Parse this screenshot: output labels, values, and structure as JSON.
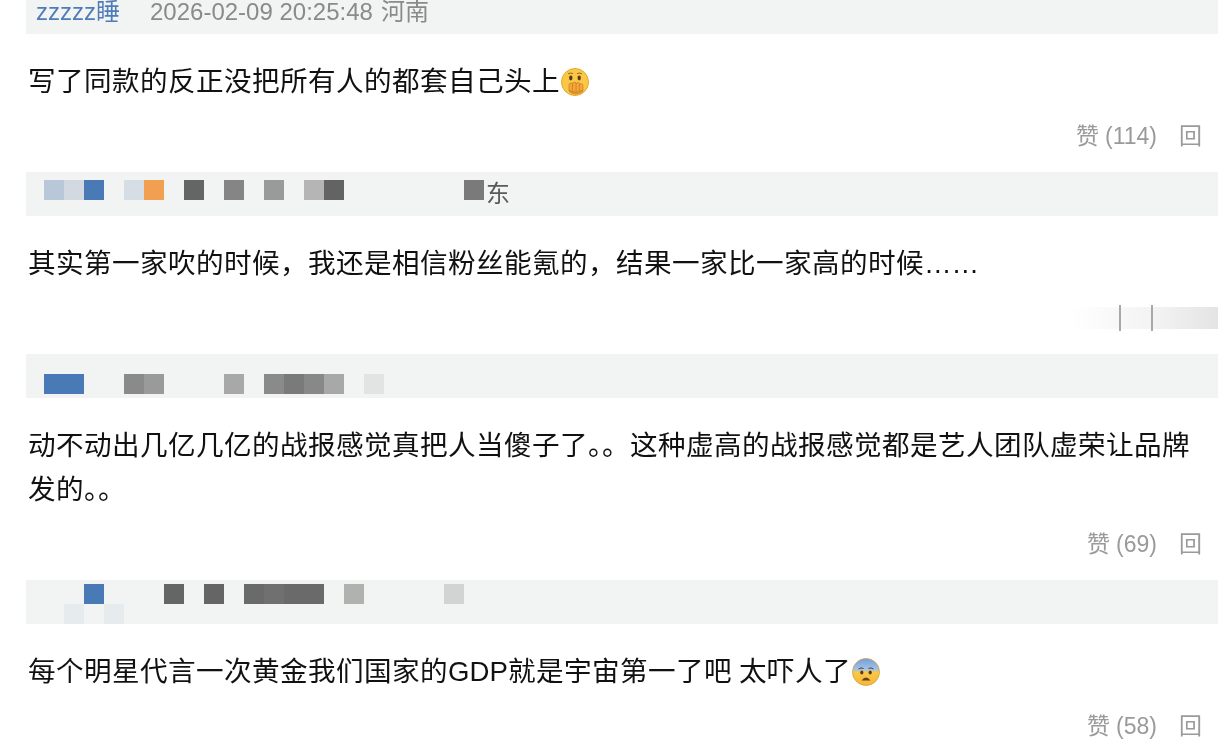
{
  "comments": [
    {
      "header": {
        "kind": "visible",
        "user": "zzzzz睡",
        "time": "2026-02-09 20:25:48",
        "location": "河南"
      },
      "lines": [
        "写了同款的反正没把所有人的都套自己头上"
      ],
      "emoji": {
        "kind": "hand_over_mouth"
      },
      "actions": {
        "kind": "links",
        "like": "赞 (114)",
        "reply": "回"
      }
    },
    {
      "header": {
        "kind": "pixelated",
        "location": "东"
      },
      "lines": [
        "其实第一家吹的时候，我还是相信粉丝能氪的，结果一家比一家高的时候……"
      ],
      "actions": {
        "kind": "blurred"
      }
    },
    {
      "header": {
        "kind": "pixelated"
      },
      "lines": [
        "动不动出几亿几亿的战报感觉真把人当傻子了。。这种虚高的战报感觉都是艺人团队虚荣让品牌",
        "发的。。"
      ],
      "actions": {
        "kind": "links",
        "like": "赞 (69)",
        "reply": "回"
      }
    },
    {
      "header": {
        "kind": "pixelated"
      },
      "lines": [
        "每个明星代言一次黄金我们国家的GDP就是宇宙第一了吧 太吓人了"
      ],
      "emoji": {
        "kind": "fearful"
      },
      "actions": {
        "kind": "links",
        "like": "赞 (58)",
        "reply": "回"
      }
    }
  ]
}
